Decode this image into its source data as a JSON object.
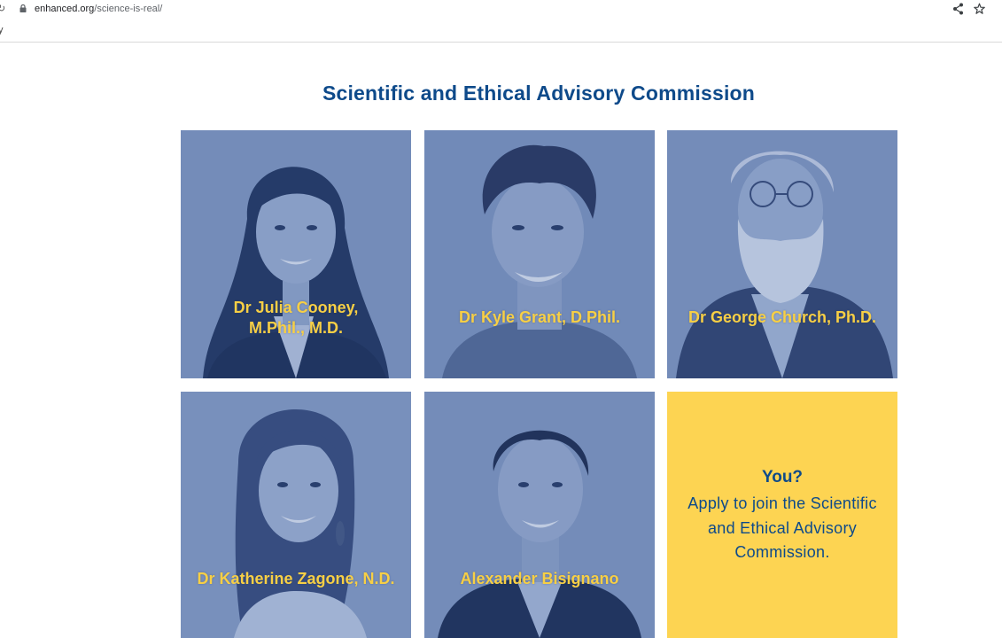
{
  "browser": {
    "url_domain": "enhanced.org",
    "url_path": "/science-is-real/",
    "bookmark_fragment": "y"
  },
  "page": {
    "title": "Scientific and Ethical Advisory Commission"
  },
  "members": [
    {
      "name_line1": "Dr Julia Cooney,",
      "name_line2": "M.Phil., M.D."
    },
    {
      "name_line1": "Dr Kyle Grant, D.Phil.",
      "name_line2": ""
    },
    {
      "name_line1": "Dr George Church, Ph.D.",
      "name_line2": ""
    },
    {
      "name_line1": "Dr Katherine Zagone, N.D.",
      "name_line2": ""
    },
    {
      "name_line1": "Alexander Bisignano",
      "name_line2": ""
    }
  ],
  "cta": {
    "heading": "You?",
    "text": "Apply to join the Scientific and Ethical Advisory Commission."
  },
  "colors": {
    "title": "#0e4a8a",
    "name": "#f7cf45",
    "cta_background": "#fdd452",
    "card_tint": "#7d93b8"
  }
}
